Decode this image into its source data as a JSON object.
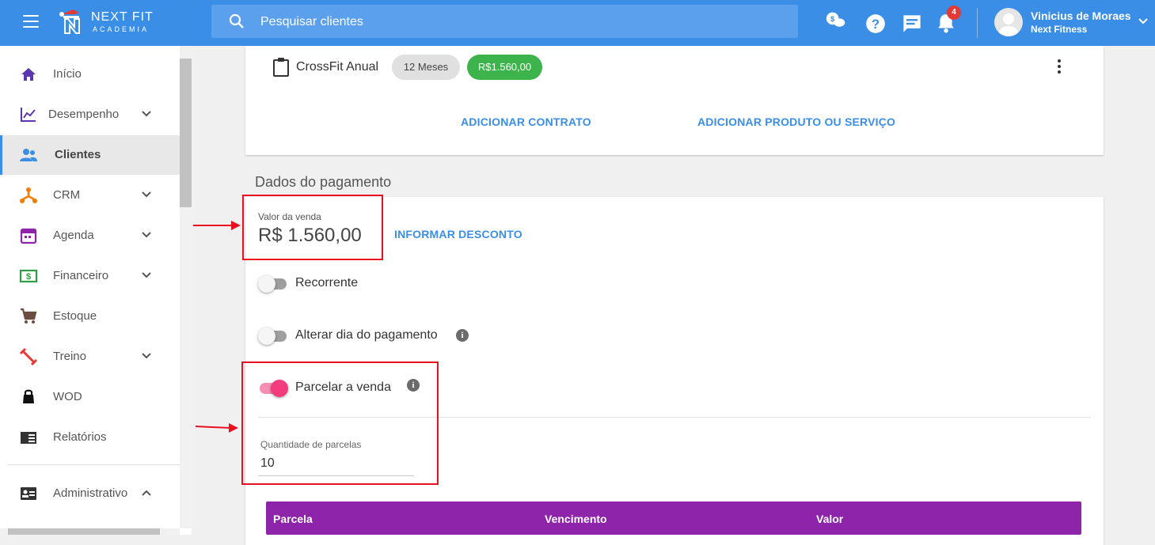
{
  "brand": {
    "name": "NEXT FIT",
    "sub": "ACADEMIA"
  },
  "search": {
    "placeholder": "Pesquisar clientes"
  },
  "notifications": {
    "count": "4"
  },
  "user": {
    "name": "Vinicius de Moraes",
    "org": "Next Fitness"
  },
  "sidebar": {
    "items": [
      {
        "label": "Início",
        "icon": "home-icon",
        "chevron": false
      },
      {
        "label": "Desempenho",
        "icon": "chart-line-icon",
        "chevron": true
      },
      {
        "label": "Clientes",
        "icon": "people-icon",
        "chevron": false,
        "active": true
      },
      {
        "label": "CRM",
        "icon": "crm-network-icon",
        "chevron": true
      },
      {
        "label": "Agenda",
        "icon": "calendar-icon",
        "chevron": true
      },
      {
        "label": "Financeiro",
        "icon": "money-icon",
        "chevron": true
      },
      {
        "label": "Estoque",
        "icon": "cart-icon",
        "chevron": false
      },
      {
        "label": "Treino",
        "icon": "dumbbell-icon",
        "chevron": true
      },
      {
        "label": "WOD",
        "icon": "kettlebell-icon",
        "chevron": false
      },
      {
        "label": "Relatórios",
        "icon": "report-icon",
        "chevron": false
      },
      {
        "label": "Administrativo",
        "icon": "id-card-icon",
        "chevron": true
      }
    ]
  },
  "product": {
    "name": "CrossFit Anual",
    "duration": "12 Meses",
    "price": "R$1.560,00",
    "add_contract": "ADICIONAR CONTRATO",
    "add_product": "ADICIONAR PRODUTO OU SERVIÇO"
  },
  "payment": {
    "section_title": "Dados do pagamento",
    "sale_label": "Valor da venda",
    "sale_value": "R$ 1.560,00",
    "discount_link": "INFORMAR DESCONTO",
    "recurring_label": "Recorrente",
    "recurring_on": false,
    "change_day_label": "Alterar dia do pagamento",
    "change_day_on": false,
    "installments_label": "Parcelar a venda",
    "installments_on": true,
    "qty_label": "Quantidade de parcelas",
    "qty_value": "10"
  },
  "table": {
    "columns": [
      "Parcela",
      "Vencimento",
      "Valor"
    ]
  },
  "colors": {
    "primary": "#3a8ee6",
    "accent": "#f23c7c",
    "table_header": "#8e24aa",
    "price_chip": "#3cb44b",
    "annotation": "#e8101e"
  }
}
